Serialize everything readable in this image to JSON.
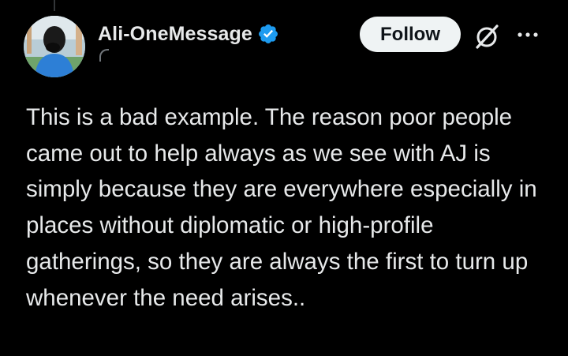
{
  "author": {
    "display_name": "Ali-OneMessage",
    "verified": true,
    "avatar_icon": "profile-photo"
  },
  "actions": {
    "follow_label": "Follow",
    "grok_icon": "grok-icon",
    "more_icon": "more-icon"
  },
  "tweet": {
    "text": "This is a bad example. The reason poor people came out to help always as we see with AJ is simply because they are everywhere especially in places without diplomatic or high-profile gatherings, so they are always the first to turn up whenever the need arises.."
  },
  "colors": {
    "background": "#000000",
    "text": "#e7e9ea",
    "verified_badge": "#1d9bf0",
    "follow_bg": "#eff3f4",
    "muted": "#71767b"
  }
}
